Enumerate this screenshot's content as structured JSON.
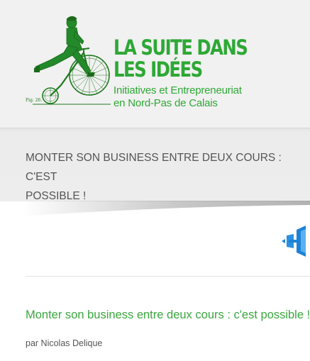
{
  "header": {
    "site_title_line1": "LA SUITE DANS",
    "site_title_line2": "LES IDÉES",
    "tagline_line1": "Initiatives et Entrepreneuriat",
    "tagline_line2": "en Nord-Pas de Calais",
    "logo_caption": "Fig. 26.",
    "logo_icon": "cyclist-penny-farthing-icon"
  },
  "page_title": {
    "line1": "MONTER SON BUSINESS ENTRE DEUX COURS : C'EST",
    "line2": "POSSIBLE !"
  },
  "nav": {
    "toggle_icon": "menu-toggle-icon"
  },
  "entry": {
    "title": "Monter son business entre deux cours : c'est possible !",
    "meta": "par Nicolas Delique"
  },
  "colors": {
    "brand_green": "#2ea836",
    "link_green": "#3aa63e",
    "toggle_blue": "#1d82d6",
    "header_bg": "#f1f1f1",
    "band_bg": "#ededed"
  }
}
